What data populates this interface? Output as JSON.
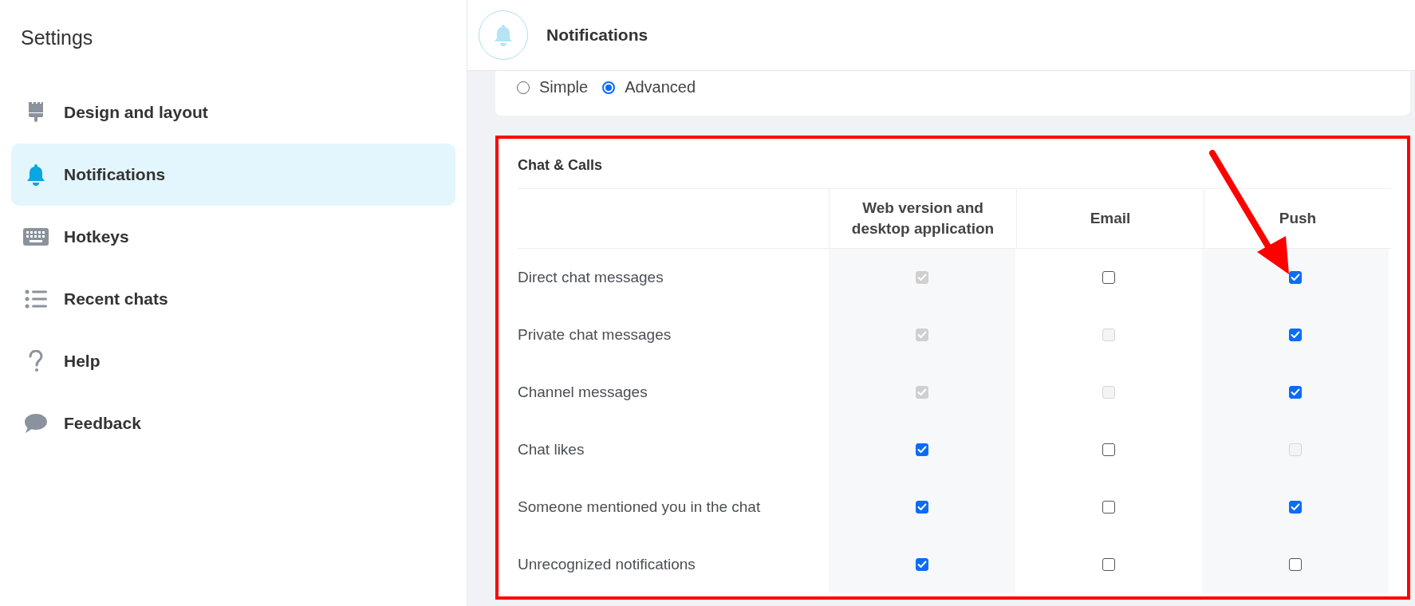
{
  "sidebar": {
    "title": "Settings",
    "items": [
      {
        "label": "Design and layout",
        "selected": false
      },
      {
        "label": "Notifications",
        "selected": true
      },
      {
        "label": "Hotkeys",
        "selected": false
      },
      {
        "label": "Recent chats",
        "selected": false
      },
      {
        "label": "Help",
        "selected": false
      },
      {
        "label": "Feedback",
        "selected": false
      }
    ]
  },
  "header": {
    "title": "Notifications"
  },
  "mode_options": [
    {
      "label": "Simple",
      "selected": false
    },
    {
      "label": "Advanced",
      "selected": true
    }
  ],
  "section": {
    "title": "Chat & Calls",
    "columns": [
      "Web version and desktop application",
      "Email",
      "Push"
    ],
    "rows": [
      {
        "label": "Direct chat messages",
        "cells": [
          {
            "checked": true,
            "disabled": true
          },
          {
            "checked": false,
            "disabled": false
          },
          {
            "checked": true,
            "disabled": false
          }
        ]
      },
      {
        "label": "Private chat messages",
        "cells": [
          {
            "checked": true,
            "disabled": true
          },
          {
            "checked": false,
            "disabled": true
          },
          {
            "checked": true,
            "disabled": false
          }
        ]
      },
      {
        "label": "Channel messages",
        "cells": [
          {
            "checked": true,
            "disabled": true
          },
          {
            "checked": false,
            "disabled": true
          },
          {
            "checked": true,
            "disabled": false
          }
        ]
      },
      {
        "label": "Chat likes",
        "cells": [
          {
            "checked": true,
            "disabled": false
          },
          {
            "checked": false,
            "disabled": false
          },
          {
            "checked": false,
            "disabled": true
          }
        ]
      },
      {
        "label": "Someone mentioned you in the chat",
        "cells": [
          {
            "checked": true,
            "disabled": false
          },
          {
            "checked": false,
            "disabled": false
          },
          {
            "checked": true,
            "disabled": false
          }
        ]
      },
      {
        "label": "Unrecognized notifications",
        "cells": [
          {
            "checked": true,
            "disabled": false
          },
          {
            "checked": false,
            "disabled": false
          },
          {
            "checked": false,
            "disabled": false
          }
        ]
      }
    ]
  }
}
